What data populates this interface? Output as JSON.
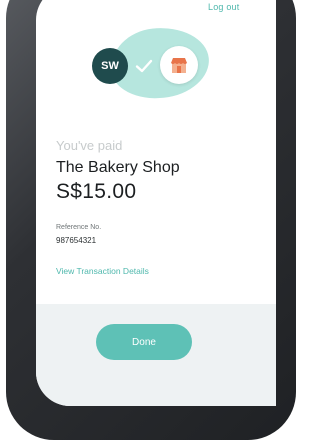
{
  "header": {
    "logout_label": "Log out"
  },
  "payer": {
    "initials": "SW"
  },
  "payment": {
    "status_text": "You've paid",
    "merchant_name": "The Bakery Shop",
    "amount": "S$15.00"
  },
  "reference": {
    "label": "Reference No.",
    "value": "987654321"
  },
  "links": {
    "view_details": "View Transaction Details"
  },
  "actions": {
    "done_label": "Done"
  },
  "colors": {
    "accent": "#5ec1b6",
    "avatar_bg": "#1f4b4d",
    "shop_icon": "#e8744a"
  },
  "icons": [
    "check-icon",
    "shop-icon"
  ]
}
